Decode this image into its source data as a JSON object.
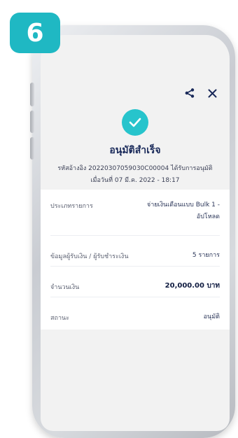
{
  "step": {
    "number": "6"
  },
  "toolbar": {
    "share_icon": "share-icon",
    "close_icon": "close-icon"
  },
  "result": {
    "title": "อนุมัติสำเร็จ",
    "ref_line1": "รหัสอ้างอิง 20220307059030C00004 ได้รับการอนุมัติ",
    "ref_line2": "เมื่อวันที่ 07 มี.ค. 2022 - 18:17"
  },
  "details": [
    {
      "label": "ประเภทรายการ",
      "value_line1": "จ่ายเงินเดือนแบบ Bulk 1 -",
      "value_line2": "อัปโหลด"
    },
    {
      "label": "ข้อมูลผู้รับเงิน / ผู้รับชำระเงิน",
      "value_line1": "5 รายการ"
    },
    {
      "label": "จำนวนเงิน",
      "value_line1": "20,000.00 บาท"
    },
    {
      "label": "สถานะ",
      "value_line1": "อนุมัติ"
    }
  ],
  "colors": {
    "accent": "#27c4cc",
    "badge": "#1fb8c3",
    "title": "#1a2a5a"
  }
}
